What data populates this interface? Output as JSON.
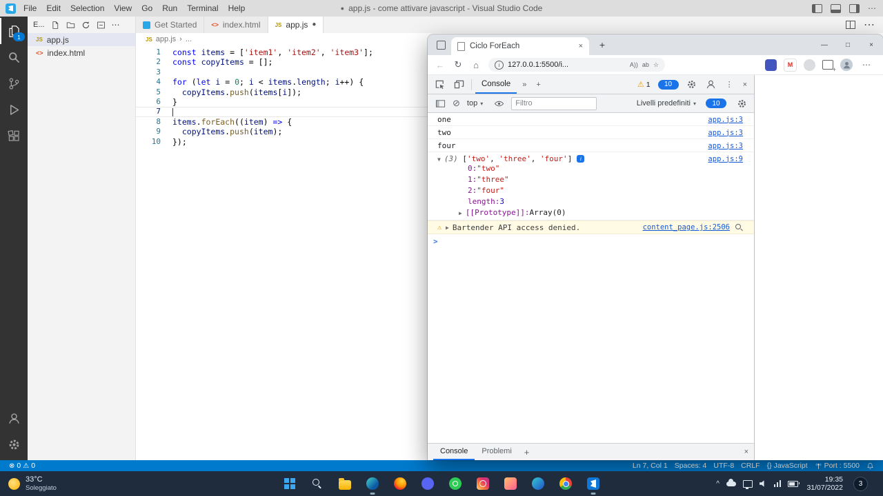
{
  "glyphs": {
    "close": "×",
    "min": "—",
    "max": "□",
    "more_h": "⋯",
    "more_v": "⋮",
    "chev_down": "▾",
    "chev_up": "^",
    "breadcrumb_sep": "›",
    "tri_open": "▼",
    "tri_closed": "▶",
    "plus": "+",
    "chevrons": "»",
    "warning": "⚠",
    "block": "⊘",
    "back": "←",
    "refresh": "↻",
    "home": "⌂",
    "star": "☆",
    "dirty": "●",
    "prompt": ">",
    "error_icon": "⊗",
    "info": "i"
  },
  "vscode": {
    "titlebar": {
      "title": "app.js - come attivare javascript - Visual Studio Code",
      "menus": [
        "File",
        "Edit",
        "Selection",
        "View",
        "Go",
        "Run",
        "Terminal",
        "Help"
      ]
    },
    "activity_badge": "1",
    "explorer": {
      "title": "E...",
      "files": [
        {
          "kind": "js",
          "icon": "JS",
          "name": "app.js",
          "selected": true
        },
        {
          "kind": "html",
          "icon": "<>",
          "name": "index.html",
          "selected": false
        }
      ]
    },
    "tabs": [
      {
        "kind": "logo",
        "icon": "",
        "label": "Get Started",
        "active": false,
        "dirty": false
      },
      {
        "kind": "html",
        "icon": "<>",
        "label": "index.html",
        "active": false,
        "dirty": false
      },
      {
        "kind": "js",
        "icon": "JS",
        "label": "app.js",
        "active": true,
        "dirty": true
      }
    ],
    "breadcrumb": {
      "icon": "JS",
      "file": "app.js",
      "more": "..."
    },
    "code": {
      "lines": [
        {
          "n": "1",
          "tokens": [
            {
              "t": "const",
              "c": "kw"
            },
            {
              "t": " ",
              "c": "pl"
            },
            {
              "t": "items",
              "c": "vr"
            },
            {
              "t": " = [",
              "c": "pl"
            },
            {
              "t": "'item1'",
              "c": "st"
            },
            {
              "t": ", ",
              "c": "pl"
            },
            {
              "t": "'item2'",
              "c": "st"
            },
            {
              "t": ", ",
              "c": "pl"
            },
            {
              "t": "'item3'",
              "c": "st"
            },
            {
              "t": "];",
              "c": "pl"
            }
          ]
        },
        {
          "n": "2",
          "tokens": [
            {
              "t": "const",
              "c": "kw"
            },
            {
              "t": " ",
              "c": "pl"
            },
            {
              "t": "copyItems",
              "c": "vr"
            },
            {
              "t": " = [];",
              "c": "pl"
            }
          ]
        },
        {
          "n": "3",
          "tokens": []
        },
        {
          "n": "4",
          "tokens": [
            {
              "t": "for",
              "c": "kw"
            },
            {
              "t": " (",
              "c": "pl"
            },
            {
              "t": "let",
              "c": "kw"
            },
            {
              "t": " ",
              "c": "pl"
            },
            {
              "t": "i",
              "c": "vr"
            },
            {
              "t": " = ",
              "c": "pl"
            },
            {
              "t": "0",
              "c": "nm"
            },
            {
              "t": "; ",
              "c": "pl"
            },
            {
              "t": "i",
              "c": "vr"
            },
            {
              "t": " < ",
              "c": "pl"
            },
            {
              "t": "items",
              "c": "vr"
            },
            {
              "t": ".",
              "c": "pl"
            },
            {
              "t": "length",
              "c": "vr"
            },
            {
              "t": "; ",
              "c": "pl"
            },
            {
              "t": "i",
              "c": "vr"
            },
            {
              "t": "++) {",
              "c": "pl"
            }
          ]
        },
        {
          "n": "5",
          "tokens": [
            {
              "t": "  ",
              "c": "pl"
            },
            {
              "t": "copyItems",
              "c": "vr"
            },
            {
              "t": ".",
              "c": "pl"
            },
            {
              "t": "push",
              "c": "fn"
            },
            {
              "t": "(",
              "c": "pl"
            },
            {
              "t": "items",
              "c": "vr"
            },
            {
              "t": "[",
              "c": "pl"
            },
            {
              "t": "i",
              "c": "vr"
            },
            {
              "t": "]);",
              "c": "pl"
            }
          ]
        },
        {
          "n": "6",
          "tokens": [
            {
              "t": "}",
              "c": "pl"
            }
          ]
        },
        {
          "n": "7",
          "tokens": [],
          "current": true
        },
        {
          "n": "8",
          "tokens": [
            {
              "t": "items",
              "c": "vr"
            },
            {
              "t": ".",
              "c": "pl"
            },
            {
              "t": "forEach",
              "c": "fn"
            },
            {
              "t": "((",
              "c": "pl"
            },
            {
              "t": "item",
              "c": "vr"
            },
            {
              "t": ") ",
              "c": "pl"
            },
            {
              "t": "=>",
              "c": "kw"
            },
            {
              "t": " {",
              "c": "pl"
            }
          ]
        },
        {
          "n": "9",
          "tokens": [
            {
              "t": "  ",
              "c": "pl"
            },
            {
              "t": "copyItems",
              "c": "vr"
            },
            {
              "t": ".",
              "c": "pl"
            },
            {
              "t": "push",
              "c": "fn"
            },
            {
              "t": "(",
              "c": "pl"
            },
            {
              "t": "item",
              "c": "vr"
            },
            {
              "t": ");",
              "c": "pl"
            }
          ]
        },
        {
          "n": "10",
          "tokens": [
            {
              "t": "});",
              "c": "pl"
            }
          ]
        }
      ]
    },
    "statusbar": {
      "errors": "0",
      "warnings": "0",
      "line_col": "Ln 7, Col 1",
      "spaces": "Spaces: 4",
      "encoding": "UTF-8",
      "eol": "CRLF",
      "braces": "{}",
      "language": "JavaScript",
      "port": "Port : 5500"
    }
  },
  "browser": {
    "tab_title": "Ciclo ForEach",
    "url": "127.0.0.1:5500/i...",
    "read_aloud": "A))",
    "translate": "ab",
    "ext_mail": "M"
  },
  "devtools": {
    "panel_tab": "Console",
    "warn_count": "1",
    "msg_count": "10",
    "context": "top",
    "filter_placeholder": "Filtro",
    "levels_label": "Livelli predefiniti",
    "levels_count": "10",
    "rows": [
      {
        "type": "log",
        "text": "one",
        "source": "app.js:3"
      },
      {
        "type": "log",
        "text": "two",
        "source": "app.js:3"
      },
      {
        "type": "log",
        "text": "four",
        "source": "app.js:3"
      },
      {
        "type": "array",
        "source": "app.js:9",
        "preview": [
          {
            "t": "(3) ",
            "c": "meta"
          },
          {
            "t": "[",
            "c": "pl"
          },
          {
            "t": "'two'",
            "c": "st"
          },
          {
            "t": ", ",
            "c": "pl"
          },
          {
            "t": "'three'",
            "c": "st"
          },
          {
            "t": ", ",
            "c": "pl"
          },
          {
            "t": "'four'",
            "c": "st"
          },
          {
            "t": "]",
            "c": "pl"
          }
        ],
        "children": [
          {
            "key": "0",
            "val": "\"two\"",
            "vc": "st"
          },
          {
            "key": "1",
            "val": "\"three\"",
            "vc": "st"
          },
          {
            "key": "2",
            "val": "\"four\"",
            "vc": "st"
          },
          {
            "key": "length",
            "val": "3",
            "vc": "nm"
          },
          {
            "key": "[[Prototype]]",
            "val": "Array(0)",
            "vc": "pl",
            "toggle": true
          }
        ]
      },
      {
        "type": "warning",
        "text": "Bartender API access denied.",
        "source": "content_page.js:2506"
      }
    ],
    "drawer": [
      {
        "label": "Console",
        "active": true
      },
      {
        "label": "Problemi",
        "active": false
      }
    ]
  },
  "taskbar": {
    "weather_temp": "33°C",
    "weather_desc": "Soleggiato",
    "apps": [
      {
        "id": "file-explorer",
        "running": false
      },
      {
        "id": "edge",
        "running": true
      },
      {
        "id": "firefox",
        "running": false
      },
      {
        "id": "discord",
        "running": false
      },
      {
        "id": "whatsapp",
        "running": false
      },
      {
        "id": "instagram",
        "running": false
      },
      {
        "id": "photos",
        "running": false
      },
      {
        "id": "edge-dev",
        "running": false
      },
      {
        "id": "chrome",
        "running": false
      },
      {
        "id": "vscode",
        "running": true
      }
    ],
    "time": "19:35",
    "date": "31/07/2022",
    "notifications": "3"
  }
}
